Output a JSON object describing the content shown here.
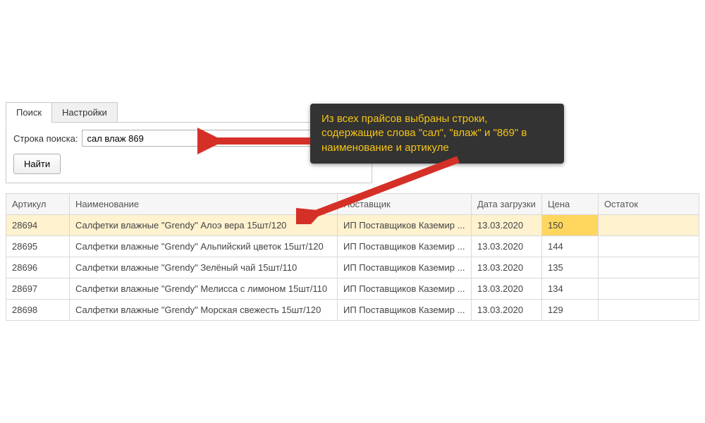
{
  "tabs": {
    "search": "Поиск",
    "settings": "Настройки"
  },
  "search": {
    "label": "Строка поиска:",
    "value": "сал влаж 869",
    "submit": "Найти"
  },
  "callout": "Из всех прайсов выбраны строки, содержащие слова \"сал\", \"влаж\" и \"869\" в наименование и артикуле",
  "table": {
    "headers": {
      "article": "Артикул",
      "name": "Наименование",
      "supplier": "Поставщик",
      "date": "Дата загрузки",
      "price": "Цена",
      "rest": "Остаток"
    },
    "rows": [
      {
        "article": "28694",
        "name": "Салфетки влажные \"Grendy\" Алоэ вера 15шт/120",
        "supplier": "ИП Поставщиков Каземир ...",
        "date": "13.03.2020",
        "price": "150",
        "rest": "",
        "selected": true
      },
      {
        "article": "28695",
        "name": "Салфетки влажные \"Grendy\" Альпийский цветок 15шт/120",
        "supplier": "ИП Поставщиков Каземир ...",
        "date": "13.03.2020",
        "price": "144",
        "rest": ""
      },
      {
        "article": "28696",
        "name": "Салфетки влажные \"Grendy\" Зелёный чай 15шт/110",
        "supplier": "ИП Поставщиков Каземир ...",
        "date": "13.03.2020",
        "price": "135",
        "rest": ""
      },
      {
        "article": "28697",
        "name": "Салфетки влажные \"Grendy\" Мелисса с лимоном 15шт/110",
        "supplier": "ИП Поставщиков Каземир ...",
        "date": "13.03.2020",
        "price": "134",
        "rest": ""
      },
      {
        "article": "28698",
        "name": "Салфетки влажные \"Grendy\" Морская свежесть 15шт/120",
        "supplier": "ИП Поставщиков Каземир ...",
        "date": "13.03.2020",
        "price": "129",
        "rest": ""
      }
    ]
  }
}
